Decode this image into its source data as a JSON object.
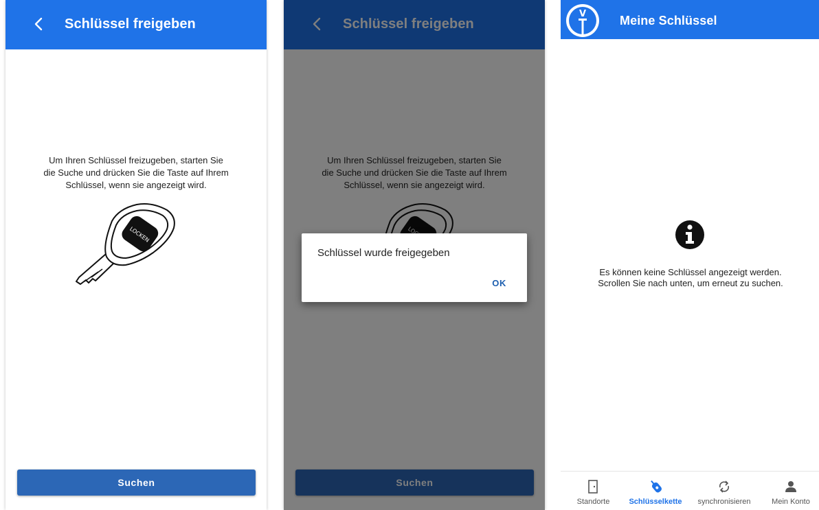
{
  "screen1": {
    "title": "Schlüssel freigeben",
    "instructions": [
      "Um Ihren Schlüssel freizugeben, starten Sie",
      "die Suche und drücken Sie die Taste auf Ihrem",
      "Schlüssel, wenn sie angezeigt wird."
    ],
    "key_label": "LOCKEN",
    "search_button": "Suchen"
  },
  "screen2": {
    "title": "Schlüssel freigeben",
    "instructions": [
      "Um Ihren Schlüssel freizugeben, starten Sie",
      "die Suche und drücken Sie die Taste auf Ihrem",
      "Schlüssel, wenn sie angezeigt wird."
    ],
    "key_label": "LOCKEN",
    "search_button": "Suchen",
    "dialog": {
      "message": "Schlüssel wurde freigegeben",
      "ok": "OK"
    }
  },
  "screen3": {
    "title": "Meine Schlüssel",
    "logo_text": "V",
    "empty_message": [
      "Es können keine Schlüssel angezeigt werden.",
      "Scrollen Sie nach unten, um erneut zu suchen."
    ],
    "nav": [
      {
        "label": "Standorte",
        "icon": "door-icon",
        "active": false
      },
      {
        "label": "Schlüsselkette",
        "icon": "key-fob-icon",
        "active": true
      },
      {
        "label": "synchronisieren",
        "icon": "sync-icon",
        "active": false
      },
      {
        "label": "Mein Konto",
        "icon": "person-icon",
        "active": false
      }
    ]
  },
  "colors": {
    "appbar": "#1f73e8",
    "button": "#2c67b6",
    "dialog_action": "#1d5fb0",
    "nav_active": "#1f73e8"
  }
}
